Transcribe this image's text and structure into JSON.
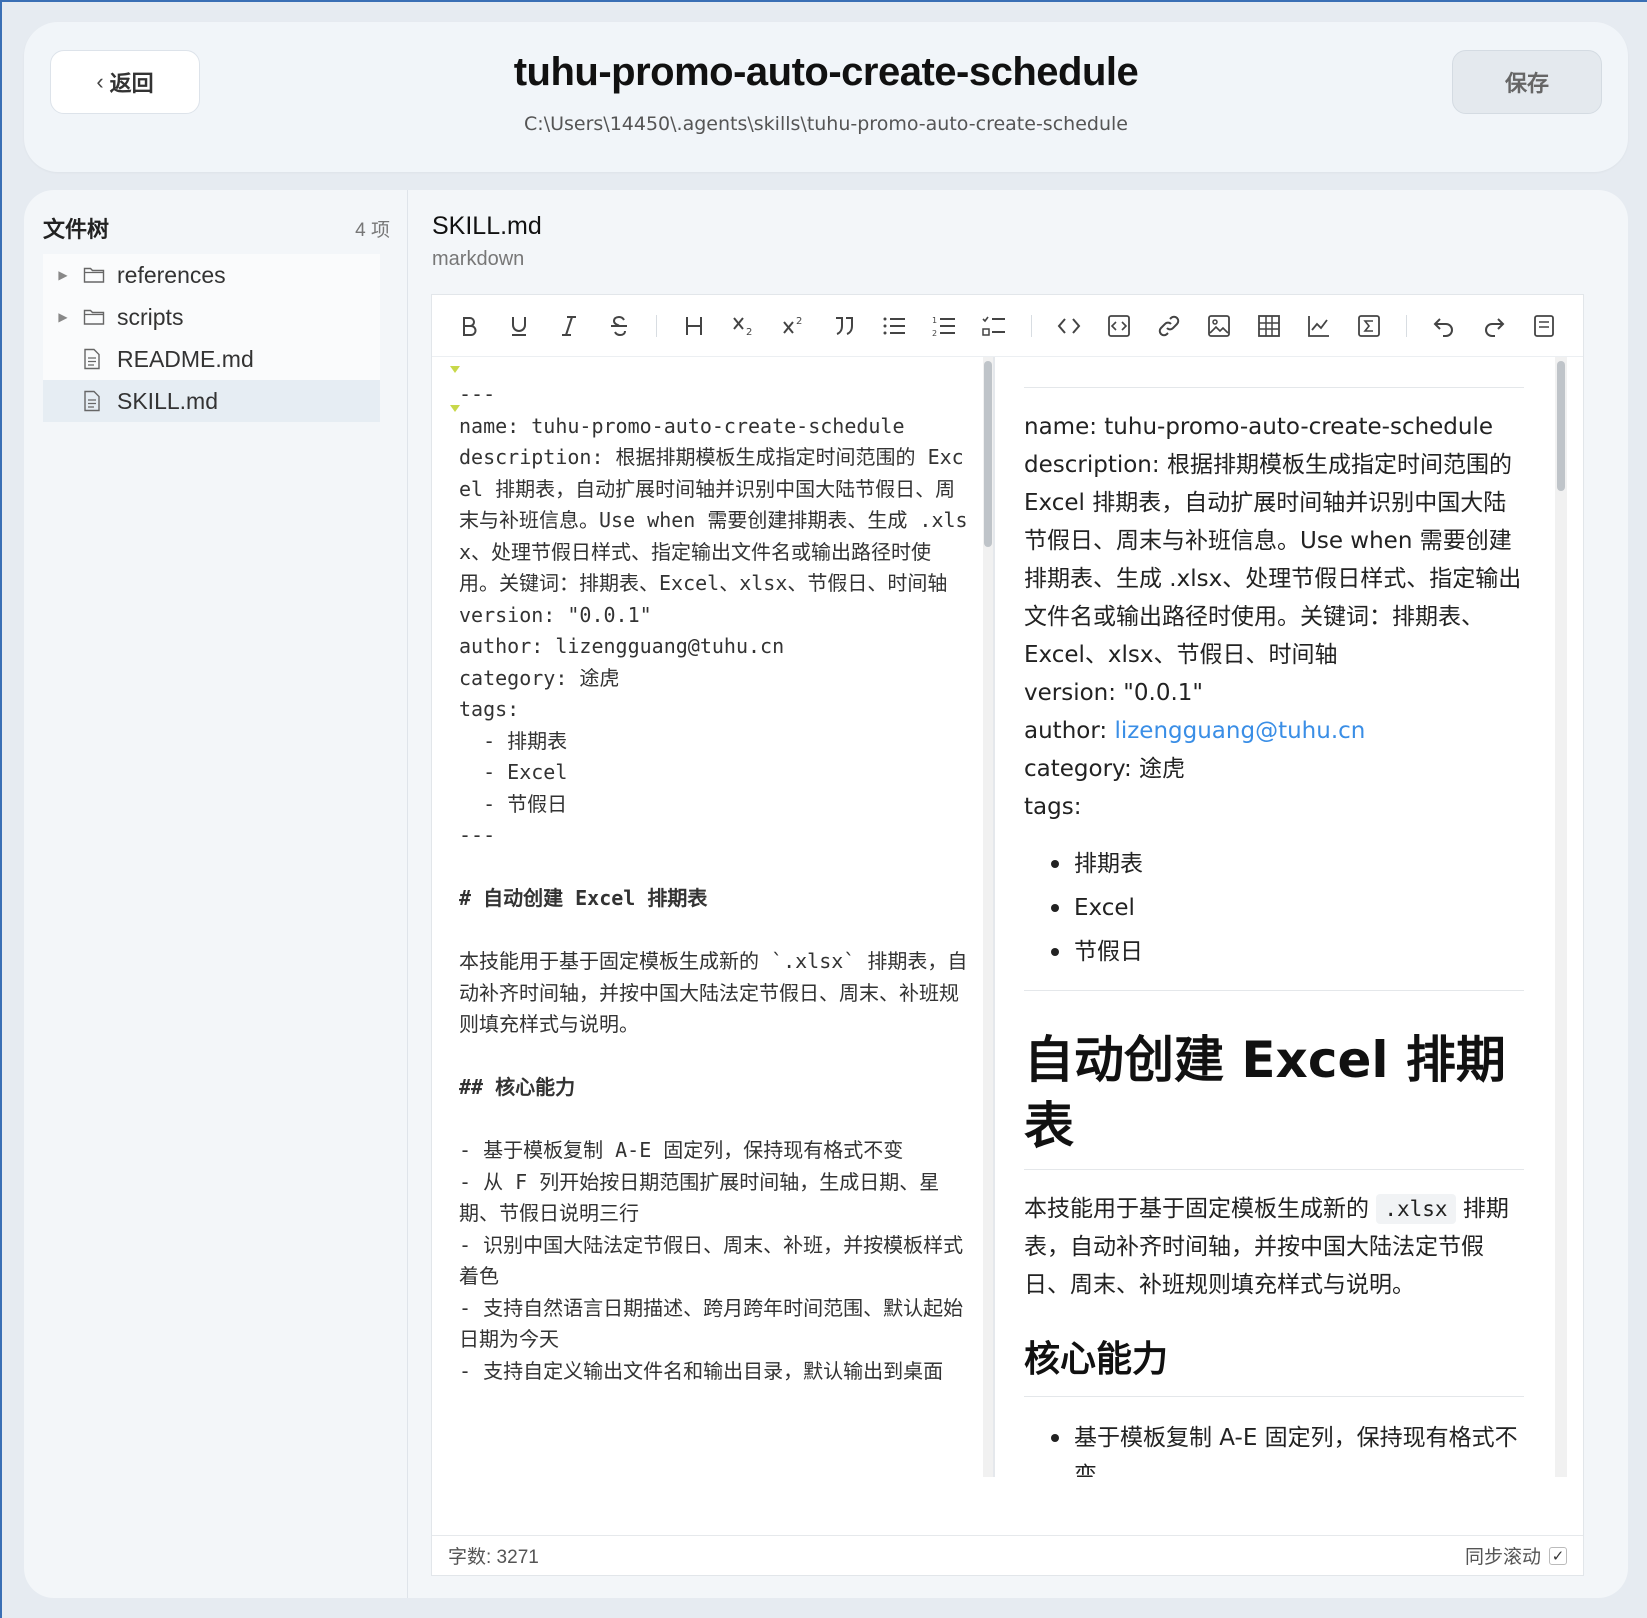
{
  "header": {
    "back_label": "返回",
    "title": "tuhu-promo-auto-create-schedule",
    "path": "C:\\Users\\14450\\.agents\\skills\\tuhu-promo-auto-create-schedule",
    "save_label": "保存"
  },
  "sidebar": {
    "title": "文件树",
    "count": "4 项",
    "items": [
      {
        "label": "references",
        "type": "folder"
      },
      {
        "label": "scripts",
        "type": "folder"
      },
      {
        "label": "README.md",
        "type": "file"
      },
      {
        "label": "SKILL.md",
        "type": "file",
        "selected": true
      }
    ]
  },
  "file": {
    "name": "SKILL.md",
    "type": "markdown"
  },
  "toolbar": {
    "icons": [
      "bold-icon",
      "underline-icon",
      "italic-icon",
      "strikethrough-icon",
      "heading-icon",
      "subscript-icon",
      "superscript-icon",
      "quote-icon",
      "bullet-list-icon",
      "ordered-list-icon",
      "task-list-icon",
      "inline-code-icon",
      "code-block-icon",
      "link-icon",
      "image-icon",
      "table-icon",
      "chart-icon",
      "formula-icon",
      "undo-icon",
      "redo-icon",
      "save-draft-icon"
    ]
  },
  "source": {
    "lines": [
      "---",
      "name: tuhu-promo-auto-create-schedule",
      "description: 根据排期模板生成指定时间范围的 Excel 排期表，自动扩展时间轴并识别中国大陆节假日、周末与补班信息。Use when 需要创建排期表、生成 .xlsx、处理节假日样式、指定输出文件名或输出路径时使用。关键词：排期表、Excel、xlsx、节假日、时间轴",
      "version: \"0.0.1\"",
      "author: lizengguang@tuhu.cn",
      "category: 途虎",
      "tags:",
      "  - 排期表",
      "  - Excel",
      "  - 节假日",
      "---",
      "",
      "# 自动创建 Excel 排期表",
      "",
      "本技能用于基于固定模板生成新的 `.xlsx` 排期表，自动补齐时间轴，并按中国大陆法定节假日、周末、补班规则填充样式与说明。",
      "",
      "## 核心能力",
      "",
      "- 基于模板复制 A-E 固定列，保持现有格式不变",
      "- 从 F 列开始按日期范围扩展时间轴，生成日期、星期、节假日说明三行",
      "- 识别中国大陆法定节假日、周末、补班，并按模板样式着色",
      "- 支持自然语言日期描述、跨月跨年时间范围、默认起始日期为今天",
      "- 支持自定义输出文件名和输出目录，默认输出到桌面"
    ]
  },
  "preview": {
    "name_line": "name: tuhu-promo-auto-create-schedule",
    "description_line": "description: 根据排期模板生成指定时间范围的 Excel 排期表，自动扩展时间轴并识别中国大陆节假日、周末与补班信息。Use when 需要创建排期表、生成 .xlsx、处理节假日样式、指定输出文件名或输出路径时使用。关键词：排期表、Excel、xlsx、节假日、时间轴",
    "version_line": "version: \"0.0.1\"",
    "author_label": "author: ",
    "author_email": "lizengguang@tuhu.cn",
    "category_line": "category: 途虎",
    "tags_label": "tags:",
    "tags": [
      "排期表",
      "Excel",
      "节假日"
    ],
    "h1": "自动创建 Excel 排期表",
    "intro_before": "本技能用于基于固定模板生成新的 ",
    "intro_code": ".xlsx",
    "intro_after": " 排期表，自动补齐时间轴，并按中国大陆法定节假日、周末、补班规则填充样式与说明。",
    "h2": "核心能力",
    "features": [
      "基于模板复制 A-E 固定列，保持现有格式不变"
    ]
  },
  "status": {
    "word_count": "字数: 3271",
    "sync_label": "同步滚动",
    "sync_checked": "✓"
  }
}
